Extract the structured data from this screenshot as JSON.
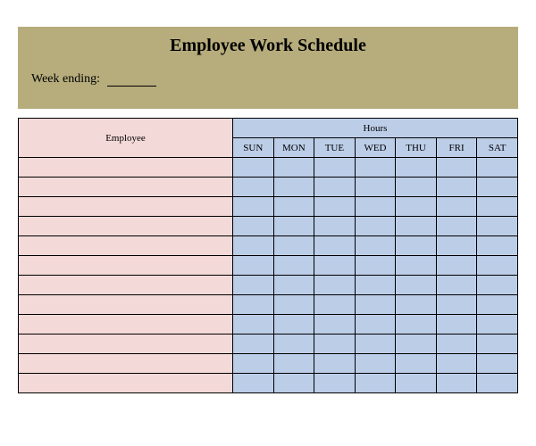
{
  "title": "Employee Work Schedule",
  "weekEndingLabel": "Week ending:",
  "weekEndingValue": "",
  "employeeHeader": "Employee",
  "hoursHeader": "Hours",
  "days": [
    "SUN",
    "MON",
    "TUE",
    "WED",
    "THU",
    "FRI",
    "SAT"
  ],
  "rows": [
    {
      "employee": "",
      "hours": [
        "",
        "",
        "",
        "",
        "",
        "",
        ""
      ]
    },
    {
      "employee": "",
      "hours": [
        "",
        "",
        "",
        "",
        "",
        "",
        ""
      ]
    },
    {
      "employee": "",
      "hours": [
        "",
        "",
        "",
        "",
        "",
        "",
        ""
      ]
    },
    {
      "employee": "",
      "hours": [
        "",
        "",
        "",
        "",
        "",
        "",
        ""
      ]
    },
    {
      "employee": "",
      "hours": [
        "",
        "",
        "",
        "",
        "",
        "",
        ""
      ]
    },
    {
      "employee": "",
      "hours": [
        "",
        "",
        "",
        "",
        "",
        "",
        ""
      ]
    },
    {
      "employee": "",
      "hours": [
        "",
        "",
        "",
        "",
        "",
        "",
        ""
      ]
    },
    {
      "employee": "",
      "hours": [
        "",
        "",
        "",
        "",
        "",
        "",
        ""
      ]
    },
    {
      "employee": "",
      "hours": [
        "",
        "",
        "",
        "",
        "",
        "",
        ""
      ]
    },
    {
      "employee": "",
      "hours": [
        "",
        "",
        "",
        "",
        "",
        "",
        ""
      ]
    },
    {
      "employee": "",
      "hours": [
        "",
        "",
        "",
        "",
        "",
        "",
        ""
      ]
    },
    {
      "employee": "",
      "hours": [
        "",
        "",
        "",
        "",
        "",
        "",
        ""
      ]
    }
  ]
}
